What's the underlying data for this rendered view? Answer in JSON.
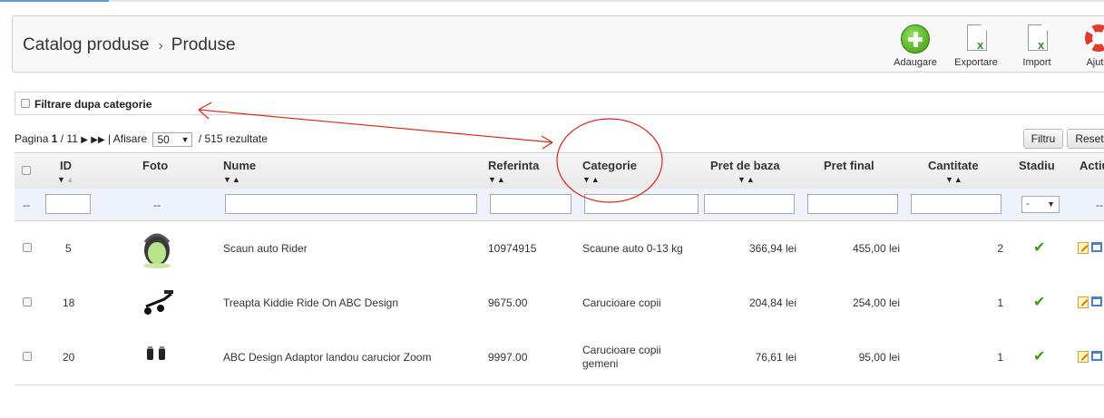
{
  "header": {
    "breadcrumb_parent": "Catalog produse",
    "breadcrumb_separator": "›",
    "breadcrumb_current": "Produse",
    "toolbar": [
      {
        "label": "Adaugare",
        "icon": "add-icon"
      },
      {
        "label": "Exportare",
        "icon": "excel-export-icon"
      },
      {
        "label": "Import",
        "icon": "excel-import-icon"
      },
      {
        "label": "Ajuto",
        "icon": "help-lifebuoy-icon"
      }
    ]
  },
  "filter": {
    "label": "Filtrare dupa categorie"
  },
  "pagination": {
    "prefix": "Pagina",
    "current": "1",
    "total": "/ 11",
    "display_label": "| Afisare",
    "per_page": "50",
    "results": "/ 515 rezultate"
  },
  "buttons": {
    "filter": "Filtru",
    "reset": "Reset"
  },
  "columns": {
    "id": "ID",
    "photo": "Foto",
    "name": "Nume",
    "reference": "Referinta",
    "category": "Categorie",
    "base_price": "Pret de baza",
    "final_price": "Pret final",
    "quantity": "Cantitate",
    "status": "Stadiu",
    "actions": "Actiu"
  },
  "filter_row": {
    "checkbox_placeholder": "--",
    "photo_placeholder": "--",
    "status_select": "-",
    "actions_placeholder": "--"
  },
  "rows": [
    {
      "id": "5",
      "name": "Scaun auto Rider",
      "reference": "10974915",
      "category_line1": "Scaune auto 0-13 kg",
      "category_line2": "",
      "base_price": "366,94 lei",
      "final_price": "455,00 lei",
      "quantity": "2",
      "thumb": "car-seat-thumbnail"
    },
    {
      "id": "18",
      "name": "Treapta Kiddie Ride On ABC Design",
      "reference": "9675.00",
      "category_line1": "Carucioare copii",
      "category_line2": "",
      "base_price": "204,84 lei",
      "final_price": "254,00 lei",
      "quantity": "1",
      "thumb": "ride-on-board-thumbnail"
    },
    {
      "id": "20",
      "name": "ABC Design Adaptor landou carucior Zoom",
      "reference": "9997.00",
      "category_line1": "Carucioare copii",
      "category_line2": "gemeni",
      "base_price": "76,61 lei",
      "final_price": "95,00 lei",
      "quantity": "1",
      "thumb": "adapter-thumbnail"
    }
  ],
  "colors": {
    "add_green": "#3d9b12",
    "annotation_red": "#d9261c",
    "filter_row_bg": "#eef3fa",
    "active_check": "#3d9b12"
  }
}
